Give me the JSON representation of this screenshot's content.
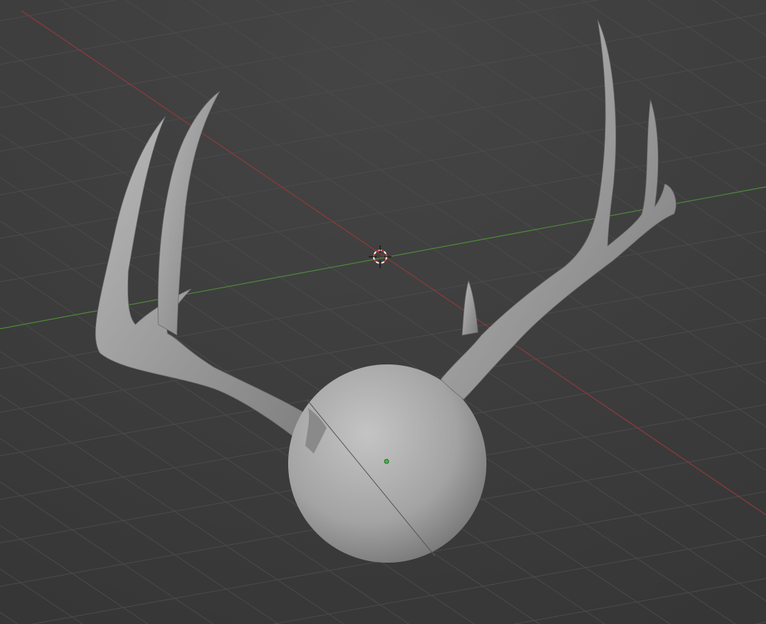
{
  "viewport": {
    "background": "#3d3d3d",
    "grid_color": "#4b4b4b",
    "x_axis_color": "#8f3a3a",
    "y_axis_color": "#4d8a3a",
    "mesh_color": "#a8a8a8",
    "origin_color": "#3fbf3f"
  },
  "icons": {
    "cursor": "3d-cursor-icon",
    "origin": "object-origin-icon"
  }
}
